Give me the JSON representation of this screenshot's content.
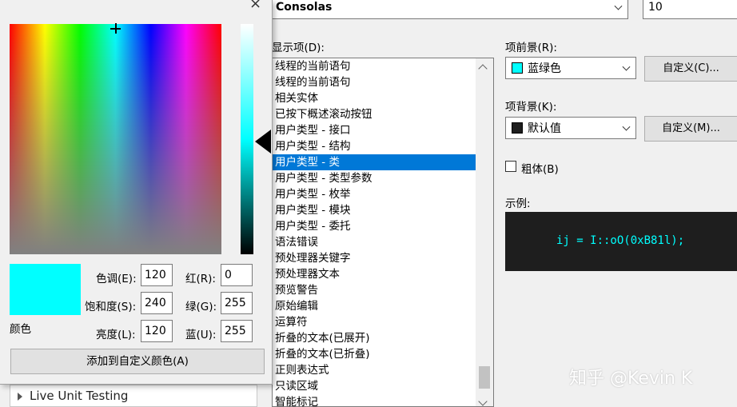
{
  "font_combo": {
    "value": "Consolas"
  },
  "size_combo": {
    "value": "10"
  },
  "display_items": {
    "label": "显示项(D):",
    "items": [
      "线程的当前语句",
      "线程的当前语句",
      "相关实体",
      "已按下概述滚动按钮",
      "用户类型 - 接口",
      "用户类型 - 结构",
      "用户类型 - 类",
      "用户类型 - 类型参数",
      "用户类型 - 枚举",
      "用户类型 - 模块",
      "用户类型 - 委托",
      "语法错误",
      "预处理器关键字",
      "预处理器文本",
      "预览警告",
      "原始编辑",
      "运算符",
      "折叠的文本(已展开)",
      "折叠的文本(已折叠)",
      "正则表达式",
      "只读区域",
      "智能标记"
    ],
    "selected_index": 6
  },
  "foreground": {
    "label": "项前景(R):",
    "value": "蓝绿色",
    "swatch": "#00ffff",
    "custom_button": "自定义(C)..."
  },
  "background": {
    "label": "项背景(K):",
    "value": "默认值",
    "swatch": "#1e1e1e",
    "custom_button": "自定义(M)..."
  },
  "bold": {
    "label": "粗体(B)",
    "checked": false
  },
  "sample": {
    "label": "示例:",
    "code": "ij = I::oO(0xB81l);",
    "bg": "#1e1e1e",
    "fg": "#00ffff"
  },
  "watermark": "知乎 @Kevin K",
  "tree_item": "Live Unit Testing",
  "color_picker": {
    "close": "×",
    "preview_label": "颜色",
    "preview_color": "#00ffff",
    "hue": {
      "label": "色调(E):",
      "value": "120"
    },
    "sat": {
      "label": "饱和度(S):",
      "value": "240"
    },
    "lum": {
      "label": "亮度(L):",
      "value": "120"
    },
    "red": {
      "label": "红(R):",
      "value": "0"
    },
    "green": {
      "label": "绿(G):",
      "value": "255"
    },
    "blue": {
      "label": "蓝(U):",
      "value": "255"
    },
    "add_button": "添加到自定义颜色(A)"
  }
}
